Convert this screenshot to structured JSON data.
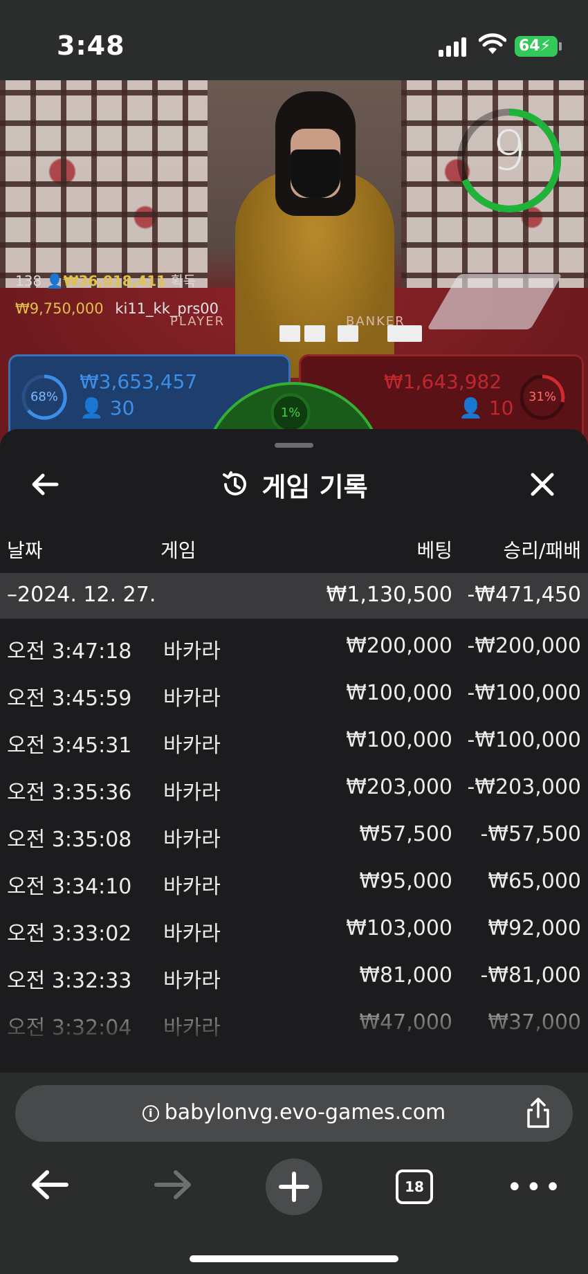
{
  "status_bar": {
    "time": "3:48",
    "battery": "64"
  },
  "video": {
    "timer": "9",
    "viewers": "138",
    "total_win": "₩36,018,411",
    "total_win_suffix": "획득",
    "last_win_amount": "₩9,750,000",
    "last_win_user": "ki11_kk_prs00",
    "player": {
      "percent": "68%",
      "amount": "₩3,653,457",
      "count": "30",
      "color": "#3c6fb3"
    },
    "banker": {
      "percent": "31%",
      "amount": "₩1,643,982",
      "count": "10",
      "color": "#c0282e"
    },
    "tie": {
      "percent": "1%",
      "color": "#33b033"
    },
    "table_labels": {
      "player": "PLAYER",
      "banker": "BANKER"
    }
  },
  "sheet": {
    "title": "게임 기록",
    "columns": {
      "date": "날짜",
      "game": "게임",
      "bet": "베팅",
      "result": "승리/패배"
    },
    "date_group": {
      "date": "–2024. 12. 27.",
      "bet_total": "₩1,130,500",
      "result_total": "-₩471,450"
    },
    "rows": [
      {
        "time": "오전 3:47:18",
        "game": "바카라",
        "bet": "₩200,000",
        "result": "-₩200,000"
      },
      {
        "time": "오전 3:45:59",
        "game": "바카라",
        "bet": "₩100,000",
        "result": "-₩100,000"
      },
      {
        "time": "오전 3:45:31",
        "game": "바카라",
        "bet": "₩100,000",
        "result": "-₩100,000"
      },
      {
        "time": "오전 3:35:36",
        "game": "바카라",
        "bet": "₩203,000",
        "result": "-₩203,000"
      },
      {
        "time": "오전 3:35:08",
        "game": "바카라",
        "bet": "₩57,500",
        "result": "-₩57,500"
      },
      {
        "time": "오전 3:34:10",
        "game": "바카라",
        "bet": "₩95,000",
        "result": "₩65,000"
      },
      {
        "time": "오전 3:33:02",
        "game": "바카라",
        "bet": "₩103,000",
        "result": "₩92,000"
      },
      {
        "time": "오전 3:32:33",
        "game": "바카라",
        "bet": "₩81,000",
        "result": "-₩81,000"
      },
      {
        "time": "오전 3:32:04",
        "game": "바카라",
        "bet": "₩47,000",
        "result": "₩37,000"
      }
    ]
  },
  "browser": {
    "url": "babylonvg.evo-games.com",
    "tab_count": "18"
  }
}
